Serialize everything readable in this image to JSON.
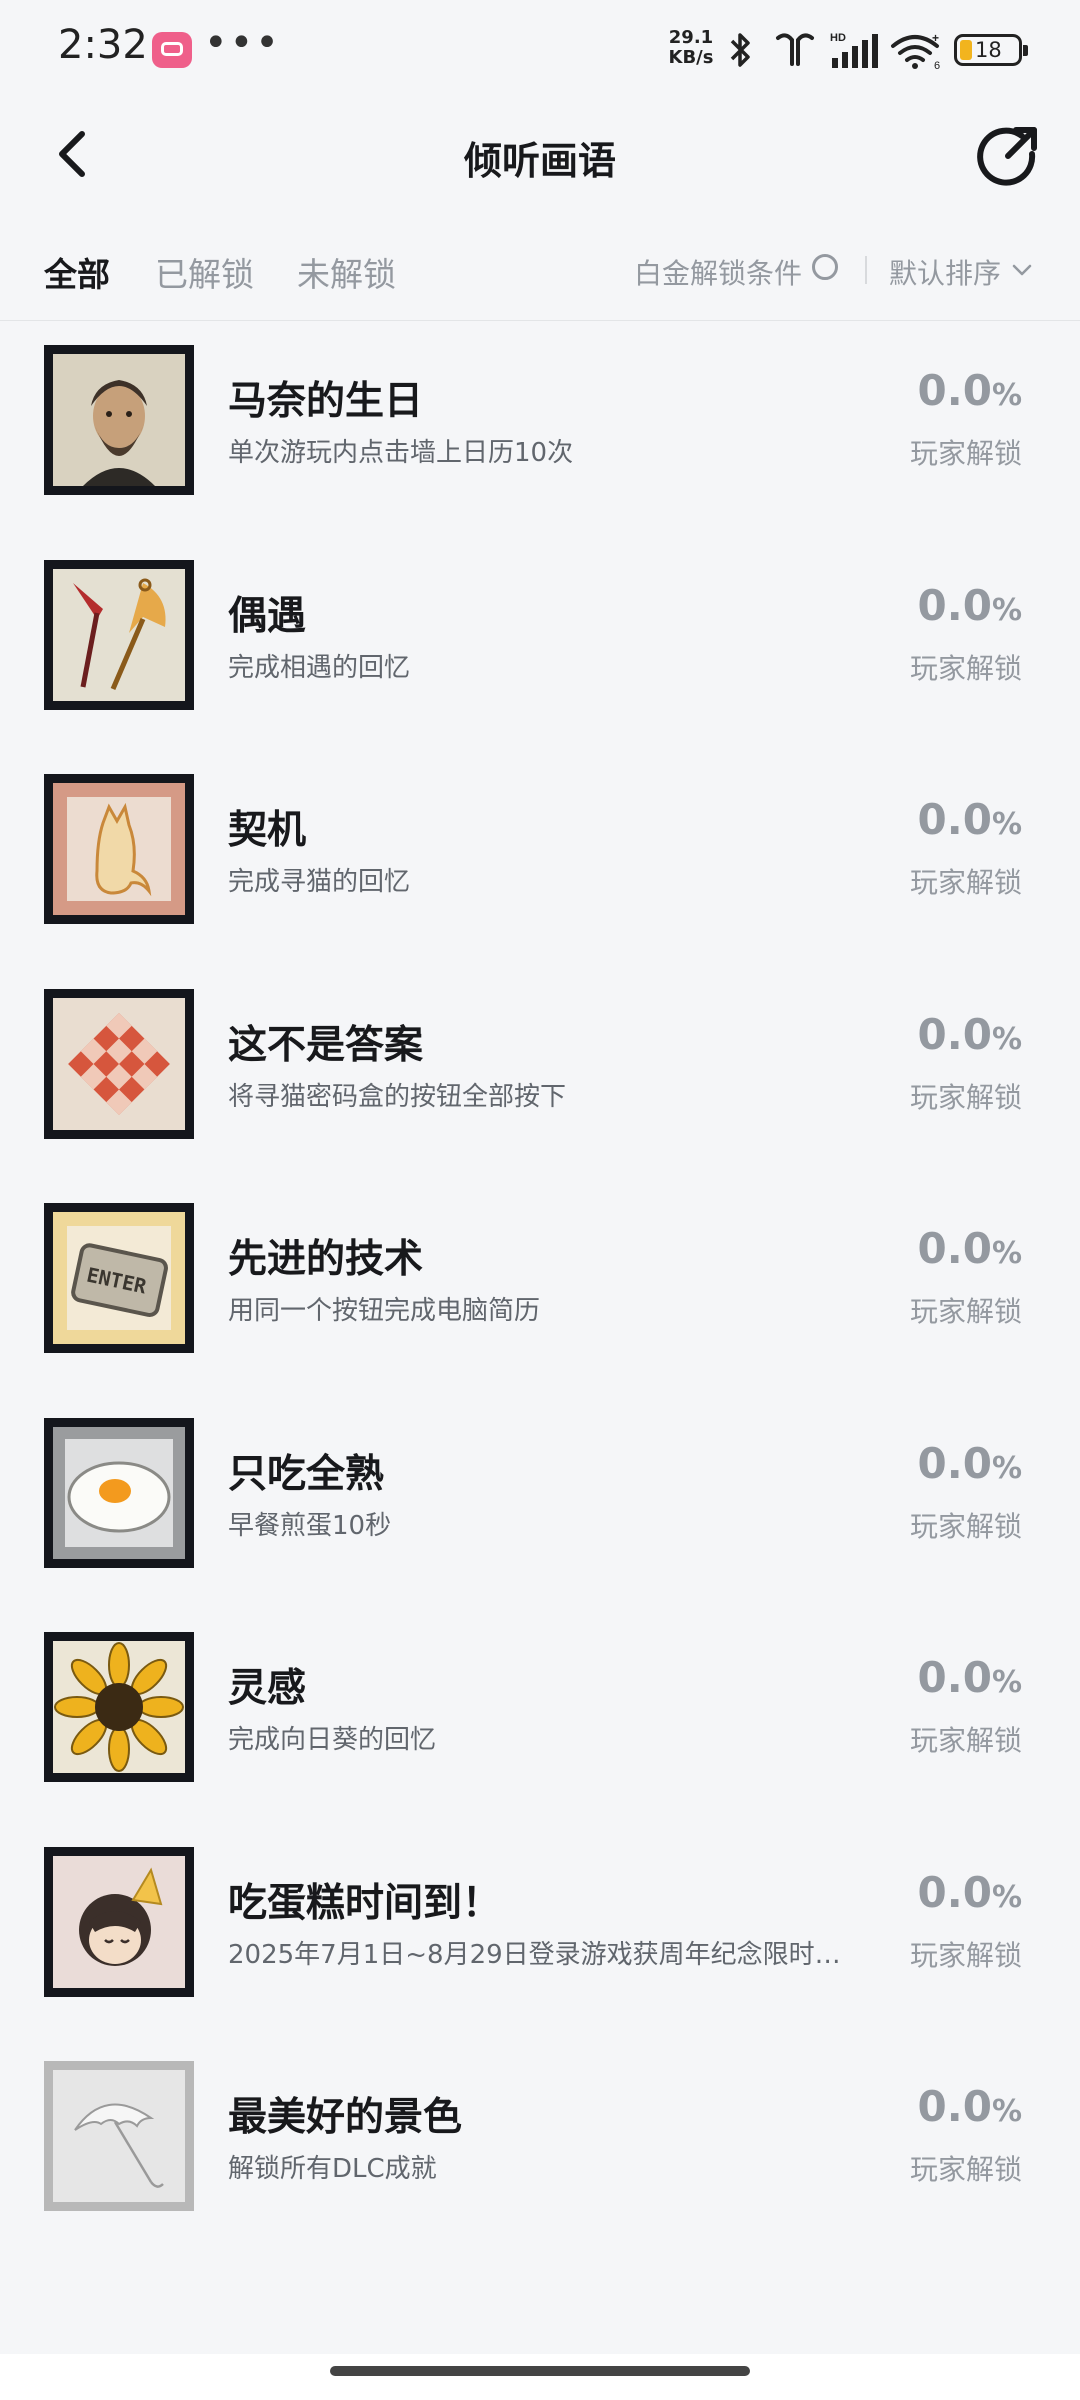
{
  "status_bar": {
    "time": "2:32",
    "net_speed_value": "29.1",
    "net_speed_unit": "KB/s",
    "battery_level": "18",
    "icons": [
      "app-badge-icon",
      "more-dots-icon",
      "bluetooth-icon",
      "earbuds-icon",
      "hd-signal-icon",
      "wifi-icon",
      "battery-icon"
    ]
  },
  "header": {
    "title": "倾听画语",
    "back_icon": "chevron-left-icon",
    "share_icon": "share-icon"
  },
  "filters": {
    "tabs": [
      {
        "label": "全部",
        "active": true
      },
      {
        "label": "已解锁",
        "active": false
      },
      {
        "label": "未解锁",
        "active": false
      }
    ],
    "platinum_label": "白金解锁条件",
    "sort_label": "默认排序"
  },
  "achievements": [
    {
      "title": "马奈的生日",
      "desc": "单次游玩内点击墙上日历10次",
      "percent": "0.0",
      "unit": "%",
      "status": "玩家解锁",
      "icon": "portrait-icon"
    },
    {
      "title": "偶遇",
      "desc": "完成相遇的回忆",
      "percent": "0.0",
      "unit": "%",
      "status": "玩家解锁",
      "icon": "umbrellas-icon"
    },
    {
      "title": "契机",
      "desc": "完成寻猫的回忆",
      "percent": "0.0",
      "unit": "%",
      "status": "玩家解锁",
      "icon": "cat-icon"
    },
    {
      "title": "这不是答案",
      "desc": "将寻猫密码盒的按钮全部按下",
      "percent": "0.0",
      "unit": "%",
      "status": "玩家解锁",
      "icon": "button-grid-icon"
    },
    {
      "title": "先进的技术",
      "desc": "用同一个按钮完成电脑简历",
      "percent": "0.0",
      "unit": "%",
      "status": "玩家解锁",
      "icon": "enter-key-icon",
      "key_text": "ENTER"
    },
    {
      "title": "只吃全熟",
      "desc": "早餐煎蛋10秒",
      "percent": "0.0",
      "unit": "%",
      "status": "玩家解锁",
      "icon": "fried-egg-icon"
    },
    {
      "title": "灵感",
      "desc": "完成向日葵的回忆",
      "percent": "0.0",
      "unit": "%",
      "status": "玩家解锁",
      "icon": "sunflower-icon"
    },
    {
      "title": "吃蛋糕时间到！",
      "desc": "2025年7月1日~8月29日登录游戏获周年纪念限时…",
      "percent": "0.0",
      "unit": "%",
      "status": "玩家解锁",
      "icon": "party-character-icon"
    },
    {
      "title": "最美好的景色",
      "desc": "解锁所有DLC成就",
      "percent": "0.0",
      "unit": "%",
      "status": "玩家解锁",
      "icon": "umbrella-sketch-icon"
    }
  ],
  "colors": {
    "background": "#f5f6f8",
    "title_text": "#18191c",
    "secondary_text": "#9499a0",
    "thumb_frame": "#14161c"
  }
}
